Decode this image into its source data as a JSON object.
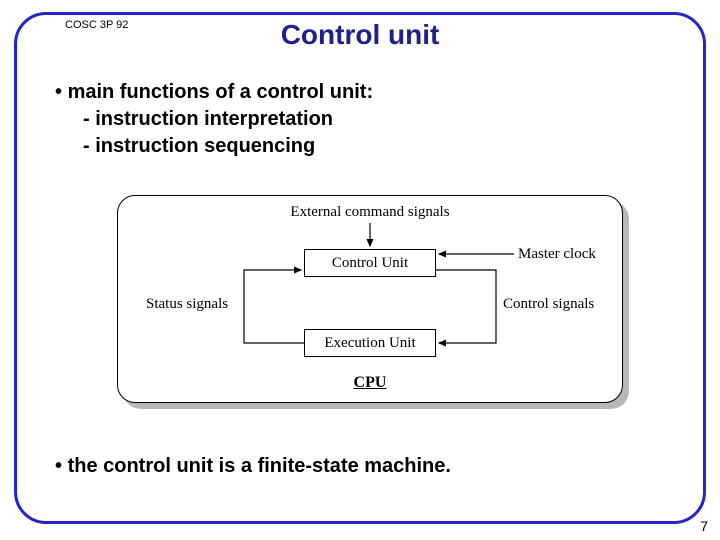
{
  "course_code": "COSC 3P 92",
  "title": "Control unit",
  "bullets": {
    "main": "main functions of a control unit:",
    "sub1": " instruction interpretation",
    "sub2": " instruction sequencing"
  },
  "diagram": {
    "external_signals": "External command signals",
    "control_unit": "Control Unit",
    "execution_unit": "Execution Unit",
    "master_clock": "Master clock",
    "control_signals": "Control signals",
    "status_signals": "Status signals",
    "cpu": "CPU"
  },
  "bullet_bottom": "the control unit is a finite-state machine.",
  "page_number": "7"
}
